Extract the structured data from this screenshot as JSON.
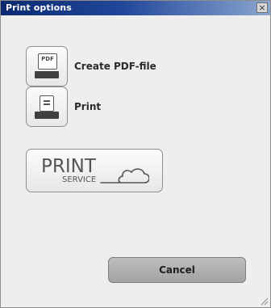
{
  "dialog": {
    "title": "Print options",
    "close_glyph": "×"
  },
  "options": {
    "create_pdf": {
      "label": "Create PDF-file",
      "icon_text": "PDF",
      "icon": "pdf-printer-icon"
    },
    "print": {
      "label": "Print",
      "icon": "printer-icon"
    },
    "print_service": {
      "logo_main": "PRINT",
      "logo_sub": "SERVICE",
      "icon": "cloud-icon"
    }
  },
  "footer": {
    "cancel_label": "Cancel"
  },
  "colors": {
    "titlebar_start": "#0b2a70",
    "titlebar_end": "#8aa6cf",
    "dialog_bg": "#eeeeee",
    "cancel_bg": "#b0b0b0"
  }
}
